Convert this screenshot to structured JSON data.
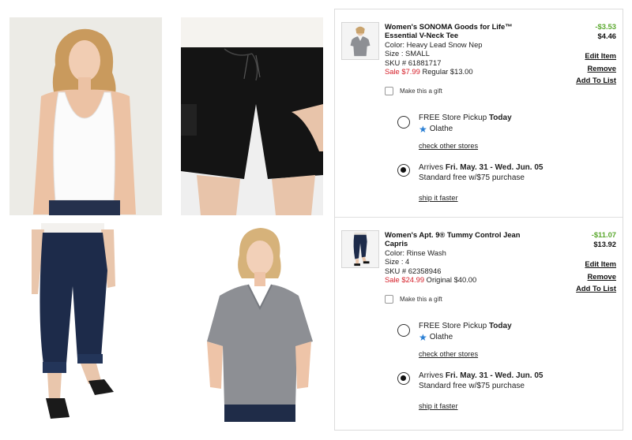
{
  "cart": {
    "items": [
      {
        "name": "Women's SONOMA Goods for Life™ Essential V-Neck Tee",
        "color": "Color: Heavy Lead Snow Nep",
        "size": "Size : SMALL",
        "sku": "SKU # 61881717",
        "sale_price": "Sale $7.99",
        "orig_price": "Regular $13.00",
        "discount": "-$3.53",
        "final_price": "$4.46",
        "edit_label": "Edit Item",
        "remove_label": "Remove",
        "add_to_list_label": "Add To List",
        "gift_label": "Make this a gift",
        "pickup_prefix": "FREE Store Pickup",
        "pickup_when": "Today",
        "pickup_store": "Olathe",
        "check_stores_label": "check other stores",
        "arrives_prefix": "Arrives",
        "arrives_dates": "Fri. May. 31 - Wed. Jun. 05",
        "shipping_note": "Standard free w/$75 purchase",
        "ship_faster_label": "ship it faster",
        "selected_option": "ship"
      },
      {
        "name": "Women's Apt. 9® Tummy Control Jean Capris",
        "color": "Color: Rinse Wash",
        "size": "Size : 4",
        "sku": "SKU # 62358946",
        "sale_price": "Sale $24.99",
        "orig_price": "Original $40.00",
        "discount": "-$11.07",
        "final_price": "$13.92",
        "edit_label": "Edit Item",
        "remove_label": "Remove",
        "add_to_list_label": "Add To List",
        "gift_label": "Make this a gift",
        "pickup_prefix": "FREE Store Pickup",
        "pickup_when": "Today",
        "pickup_store": "Olathe",
        "check_stores_label": "check other stores",
        "arrives_prefix": "Arrives",
        "arrives_dates": "Fri. May. 31 - Wed. Jun. 05",
        "shipping_note": "Standard free w/$75 purchase",
        "ship_faster_label": "ship it faster",
        "selected_option": "ship"
      }
    ]
  },
  "colors": {
    "sale": "#d6202a",
    "discount": "#5aa82e",
    "store_star": "#2a7fd4"
  },
  "icons": {
    "store_marker": "star-icon"
  }
}
